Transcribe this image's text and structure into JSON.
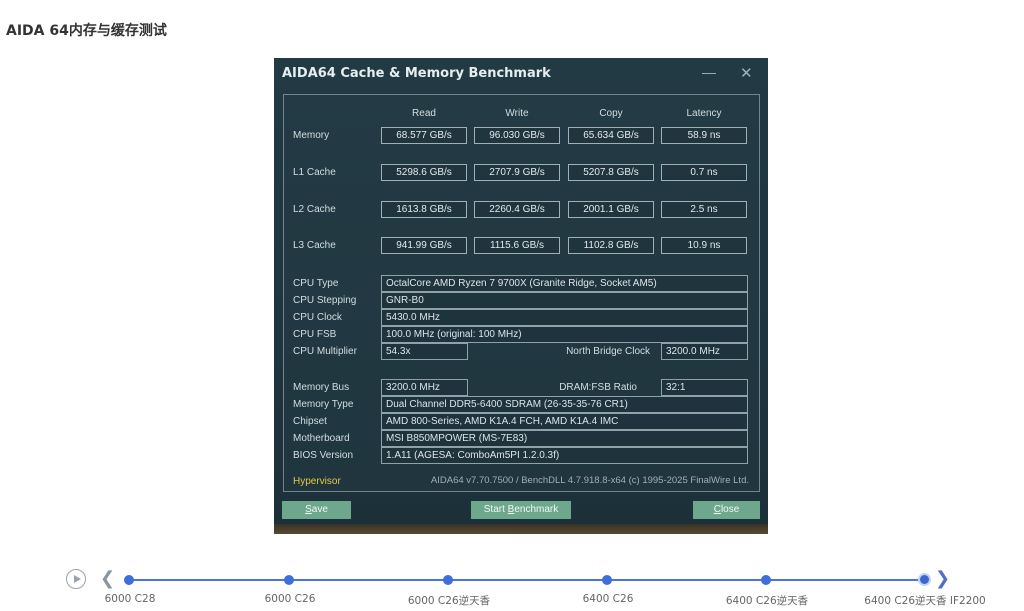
{
  "page": {
    "heading": "AIDA 64内存与缓存测试"
  },
  "window": {
    "title": "AIDA64 Cache & Memory Benchmark",
    "minimize_glyph": "—",
    "close_glyph": "✕"
  },
  "bench": {
    "columns": [
      "Read",
      "Write",
      "Copy",
      "Latency"
    ],
    "rows": [
      {
        "label": "Memory",
        "values": [
          "68.577 GB/s",
          "96.030 GB/s",
          "65.634 GB/s",
          "58.9 ns"
        ]
      },
      {
        "label": "L1 Cache",
        "values": [
          "5298.6 GB/s",
          "2707.9 GB/s",
          "5207.8 GB/s",
          "0.7 ns"
        ]
      },
      {
        "label": "L2 Cache",
        "values": [
          "1613.8 GB/s",
          "2260.4 GB/s",
          "2001.1 GB/s",
          "2.5 ns"
        ]
      },
      {
        "label": "L3 Cache",
        "values": [
          "941.99 GB/s",
          "1115.6 GB/s",
          "1102.8 GB/s",
          "10.9 ns"
        ]
      }
    ]
  },
  "cpu": {
    "type_label": "CPU Type",
    "type_value": "OctalCore AMD Ryzen 7 9700X  (Granite Ridge, Socket AM5)",
    "stepping_label": "CPU Stepping",
    "stepping_value": "GNR-B0",
    "clock_label": "CPU Clock",
    "clock_value": "5430.0 MHz",
    "fsb_label": "CPU FSB",
    "fsb_value": "100.0 MHz  (original: 100 MHz)",
    "multiplier_label": "CPU Multiplier",
    "multiplier_value": "54.3x",
    "nb_clock_label": "North Bridge Clock",
    "nb_clock_value": "3200.0 MHz"
  },
  "system": {
    "membus_label": "Memory Bus",
    "membus_value": "3200.0 MHz",
    "ratio_label": "DRAM:FSB Ratio",
    "ratio_value": "32:1",
    "memtype_label": "Memory Type",
    "memtype_value": "Dual Channel DDR5-6400 SDRAM  (26-35-35-76 CR1)",
    "chipset_label": "Chipset",
    "chipset_value": "AMD 800-Series, AMD K1A.4 FCH, AMD K1A.4 IMC",
    "motherboard_label": "Motherboard",
    "motherboard_value": "MSI B850MPOWER (MS-7E83)",
    "bios_label": "BIOS Version",
    "bios_value": "1.A11  (AGESA: ComboAm5PI 1.2.0.3f)"
  },
  "footer": {
    "hypervisor_label": "Hypervisor",
    "version_text": "AIDA64 v7.70.7500 / BenchDLL 4.7.918.8-x64  (c) 1995-2025 FinalWire Ltd."
  },
  "buttons": {
    "save_mn": "S",
    "save_rest": "ave",
    "start_pre": "Start ",
    "start_mn": "B",
    "start_rest": "enchmark",
    "close_mn": "C",
    "close_rest": "lose"
  },
  "timeline": {
    "items": [
      "6000 C28",
      "6000 C26",
      "6000 C26逆天香",
      "6400 C26",
      "6400 C26逆天香",
      "6400 C26逆天香 IF2200"
    ],
    "active_index": 5
  }
}
